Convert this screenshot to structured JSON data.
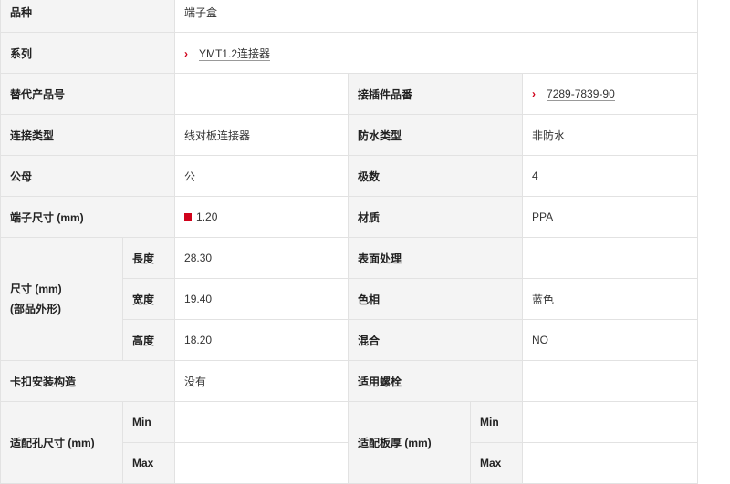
{
  "rows": {
    "category": {
      "label": "品种",
      "value": "端子盒"
    },
    "series": {
      "label": "系列",
      "link": "YMT1.2连接器"
    },
    "alt_part": {
      "label": "替代产品号",
      "value": ""
    },
    "mating_part": {
      "label": "接插件品番",
      "link": "7289-7839-90"
    },
    "connection_type": {
      "label": "连接类型",
      "value": "线对板连接器"
    },
    "waterproof": {
      "label": "防水类型",
      "value": "非防水"
    },
    "gender": {
      "label": "公母",
      "value": "公"
    },
    "poles": {
      "label": "极数",
      "value": "4"
    },
    "terminal_size": {
      "label": "端子尺寸 (mm)",
      "value": "1.20",
      "swatch_color": "#d0021b"
    },
    "material": {
      "label": "材质",
      "value": "PPA"
    },
    "dimensions": {
      "label_line1": "尺寸 (mm)",
      "label_line2": "(部品外形)",
      "length": {
        "label": "長度",
        "value": "28.30"
      },
      "width": {
        "label": "宽度",
        "value": "19.40"
      },
      "height": {
        "label": "高度",
        "value": "18.20"
      }
    },
    "surface": {
      "label": "表面处理",
      "value": ""
    },
    "color": {
      "label": "色相",
      "value": "蓝色"
    },
    "mixed": {
      "label": "混合",
      "value": "NO"
    },
    "clip": {
      "label": "卡扣安装构造",
      "value": "没有"
    },
    "bolt": {
      "label": "适用螺栓",
      "value": ""
    },
    "hole_size": {
      "label": "适配孔尺寸 (mm)",
      "min_label": "Min",
      "max_label": "Max",
      "min": "",
      "max": ""
    },
    "panel_thickness": {
      "label": "适配板厚 (mm)",
      "min_label": "Min",
      "max_label": "Max",
      "min": "",
      "max": ""
    }
  }
}
